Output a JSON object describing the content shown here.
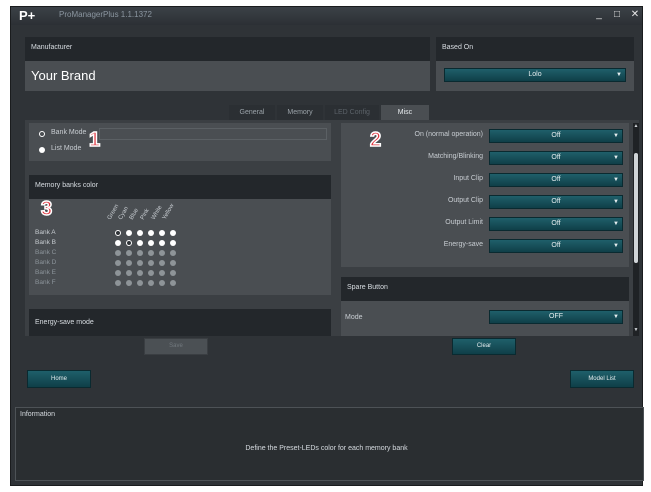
{
  "window": {
    "logo": "P+",
    "title": "ProManagerPlus 1.1.1372",
    "minimize": "_",
    "maximize": "□",
    "close": "✕"
  },
  "manufacturer": {
    "label": "Manufacturer",
    "value": "Your Brand"
  },
  "based_on": {
    "label": "Based On",
    "value": "Lolo"
  },
  "tabs": [
    {
      "label": "General",
      "active": false
    },
    {
      "label": "Memory",
      "active": false
    },
    {
      "label": "LED Config",
      "active": false
    },
    {
      "label": "Misc",
      "active": true
    }
  ],
  "mode": {
    "bank_mode": "Bank Mode",
    "list_mode": "List Mode",
    "selected": "list_mode"
  },
  "memory_banks": {
    "title": "Memory banks color",
    "colors": [
      "Green",
      "Cyan",
      "Blue",
      "Pink",
      "White",
      "Yellow"
    ],
    "banks": [
      {
        "label": "Bank A",
        "active": true,
        "dots": [
          "ring",
          "white",
          "white",
          "white",
          "white",
          "white"
        ]
      },
      {
        "label": "Bank B",
        "active": true,
        "dots": [
          "white",
          "ring",
          "white",
          "white",
          "white",
          "white"
        ]
      },
      {
        "label": "Bank C",
        "active": false,
        "dots": [
          "grey",
          "grey",
          "grey",
          "grey",
          "grey",
          "grey"
        ]
      },
      {
        "label": "Bank D",
        "active": false,
        "dots": [
          "grey",
          "grey",
          "grey",
          "grey",
          "grey",
          "grey"
        ]
      },
      {
        "label": "Bank E",
        "active": false,
        "dots": [
          "grey",
          "grey",
          "grey",
          "grey",
          "grey",
          "grey"
        ]
      },
      {
        "label": "Bank F",
        "active": false,
        "dots": [
          "grey",
          "grey",
          "grey",
          "grey",
          "grey",
          "grey"
        ]
      }
    ]
  },
  "energy_save_mode": {
    "title": "Energy-save mode"
  },
  "leds": [
    {
      "label": "On (normal operation)",
      "value": "Off"
    },
    {
      "label": "Matching/Blinking",
      "value": "Off"
    },
    {
      "label": "Input Clip",
      "value": "Off"
    },
    {
      "label": "Output Clip",
      "value": "Off"
    },
    {
      "label": "Output Limit",
      "value": "Off"
    },
    {
      "label": "Energy-save",
      "value": "Off"
    }
  ],
  "spare_button": {
    "title": "Spare Button",
    "mode_label": "Mode",
    "mode_value": "OFF"
  },
  "buttons": {
    "save": "Save",
    "clear": "Clear",
    "home": "Home",
    "model_list": "Model List"
  },
  "information": {
    "label": "Information",
    "text": "Define the Preset-LEDs color for each memory bank"
  },
  "callouts": [
    "1",
    "2",
    "3"
  ],
  "colors": {
    "accent": "#0f3f48",
    "callout": "#e0313b"
  }
}
